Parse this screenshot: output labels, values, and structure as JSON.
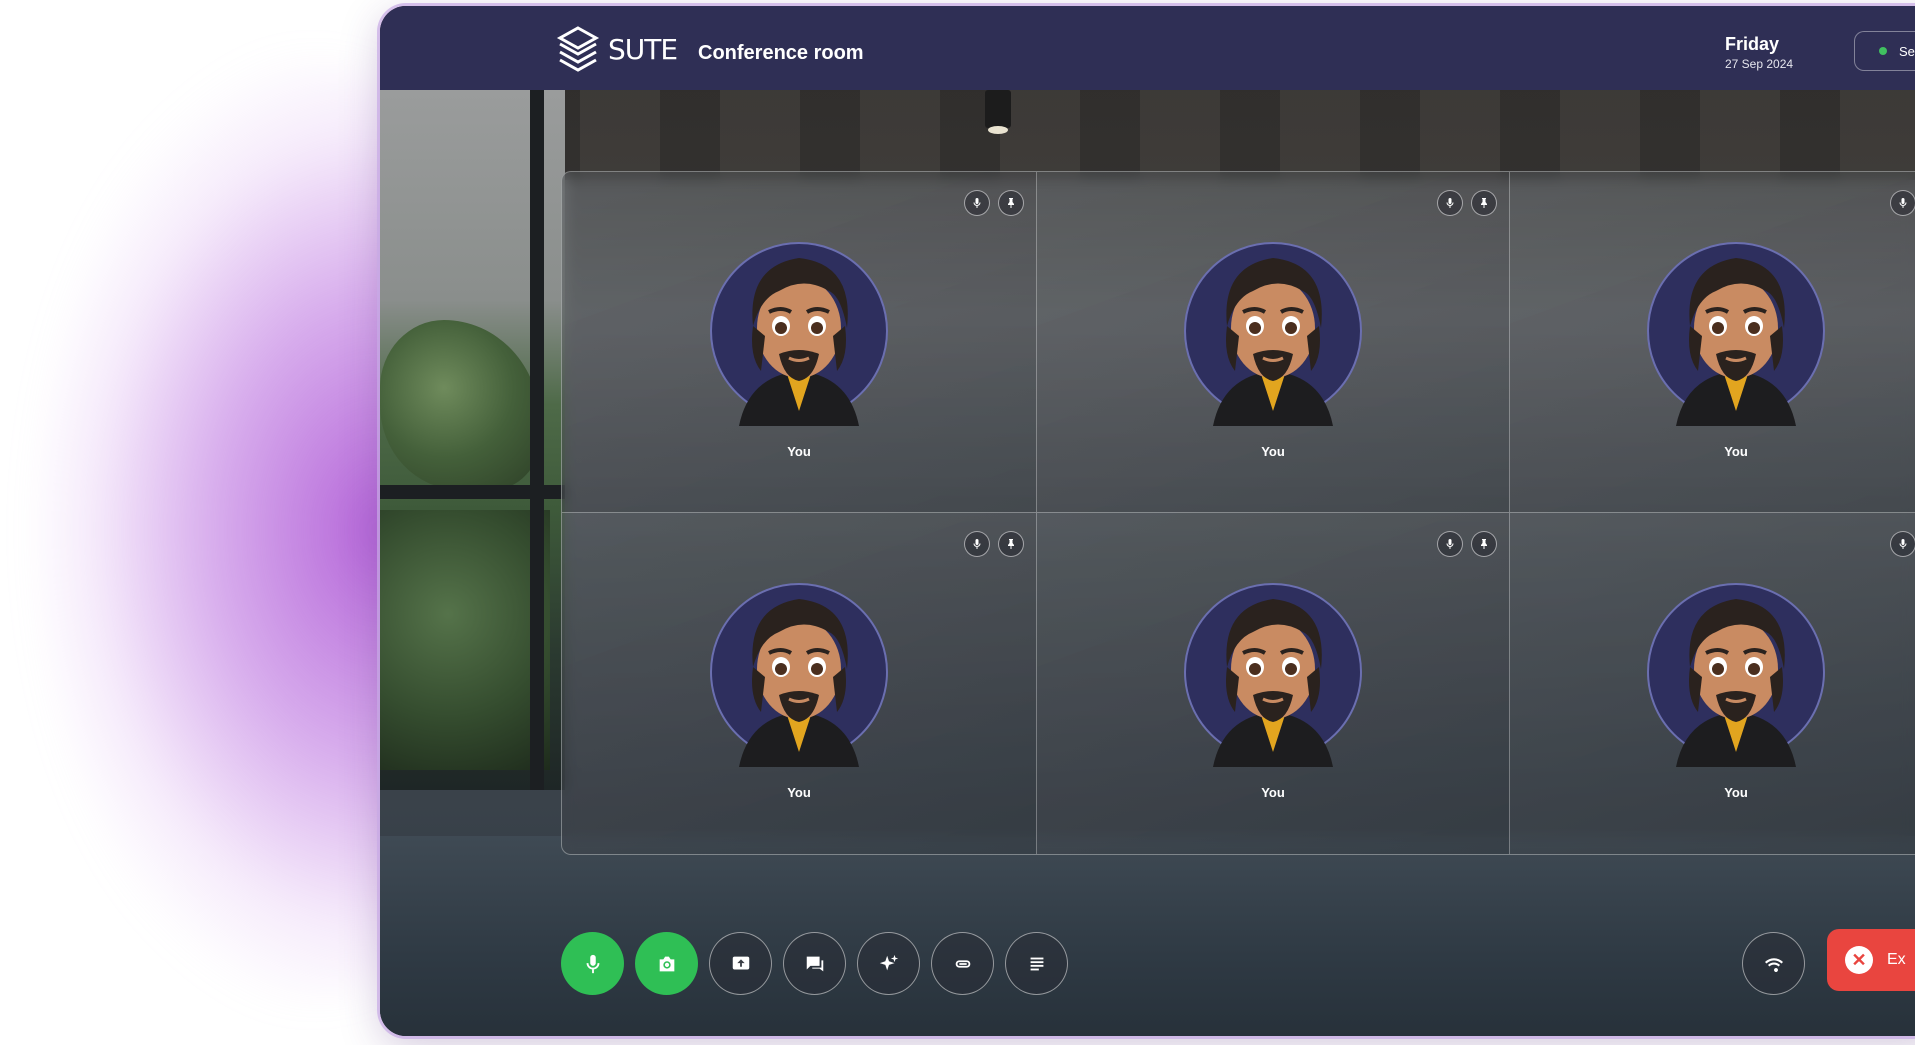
{
  "app": {
    "brand": "SUTE",
    "room_title": "Conference room"
  },
  "header": {
    "day": "Friday",
    "date": "27 Sep 2024",
    "status_label": "Se"
  },
  "participants": [
    {
      "name": "You"
    },
    {
      "name": "You"
    },
    {
      "name": "You"
    },
    {
      "name": "You"
    },
    {
      "name": "You"
    },
    {
      "name": "You"
    }
  ],
  "controls": {
    "mic": "microphone-icon",
    "camera": "camera-icon",
    "share": "share-screen-icon",
    "chat": "chat-icon",
    "effects": "sparkle-icon",
    "link": "link-icon",
    "notes": "notes-icon",
    "network": "wifi-icon",
    "exit_label": "Ex"
  },
  "colors": {
    "header_bg": "#2f2f55",
    "active_green": "#2fbf55",
    "exit_red": "#e9453f",
    "glow_purple": "#b05cd6"
  }
}
